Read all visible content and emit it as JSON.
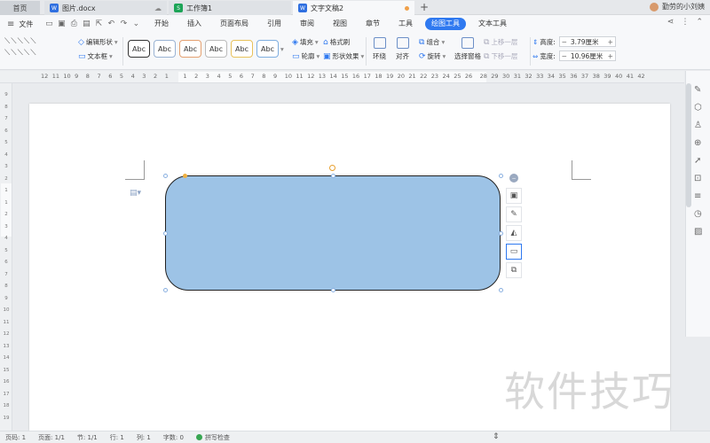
{
  "tabs": {
    "home": "首页",
    "doc1": "图片.docx",
    "doc2": "工作簿1",
    "active": "文字文稿2",
    "new_tab": "+"
  },
  "user": {
    "name": "勤劳的小刘姨"
  },
  "menubar": {
    "file": "文件",
    "menus": [
      "开始",
      "插入",
      "页面布局",
      "引用",
      "审阅",
      "视图",
      "章节",
      "工具",
      "绘图工具",
      "文本工具"
    ],
    "active_menu": "绘图工具"
  },
  "ribbon": {
    "edit_shape": "编辑形状",
    "text_box": "文本框",
    "style_preset": "Abc",
    "fill": "填充",
    "format_painter": "格式刷",
    "outline": "轮廓",
    "shape_effects": "形状效果",
    "wrap": "环绕",
    "align": "对齐",
    "group": "组合",
    "rotate": "旋转",
    "select_pane": "选择窗格",
    "bring_forward": "上移一层",
    "send_backward": "下移一层",
    "height_label": "高度:",
    "height_value": "3.79厘米",
    "width_label": "宽度:",
    "width_value": "10.96厘米",
    "minus": "−",
    "plus": "+"
  },
  "ruler": {
    "ticks": [
      "12",
      "11",
      "10",
      "9",
      "8",
      "7",
      "6",
      "5",
      "4",
      "3",
      "2",
      "1",
      "1",
      "2",
      "3",
      "4",
      "5",
      "6",
      "7",
      "8",
      "9",
      "10",
      "11",
      "12",
      "13",
      "14",
      "15",
      "16",
      "17",
      "18",
      "19",
      "20",
      "21",
      "22",
      "23",
      "24",
      "25",
      "26",
      "28",
      "29",
      "30",
      "31",
      "32",
      "33",
      "34",
      "35",
      "36",
      "37",
      "38",
      "39",
      "40",
      "41",
      "42"
    ]
  },
  "watermark": "软件技巧",
  "status": {
    "page_num": "页码: 1",
    "pages": "页面: 1/1",
    "section": "节: 1/1",
    "row": "行: 1",
    "col": "列: 1",
    "word_count": "字数: 0",
    "spell_check": "拼写检查"
  },
  "colors": {
    "accent": "#2f79f0",
    "shape_fill": "#9dc3e6",
    "shape_border": "#222222"
  },
  "icons": {
    "floating_toolbar": [
      "minus-circle-icon",
      "layout-icon",
      "pen-icon",
      "fill-icon",
      "outline-icon",
      "more-icon"
    ],
    "right_panel": [
      "pen-icon",
      "shapes-icon",
      "pin-icon",
      "download-icon",
      "cursor-icon",
      "lock-icon",
      "sliders-icon",
      "history-icon",
      "image-icon"
    ]
  }
}
